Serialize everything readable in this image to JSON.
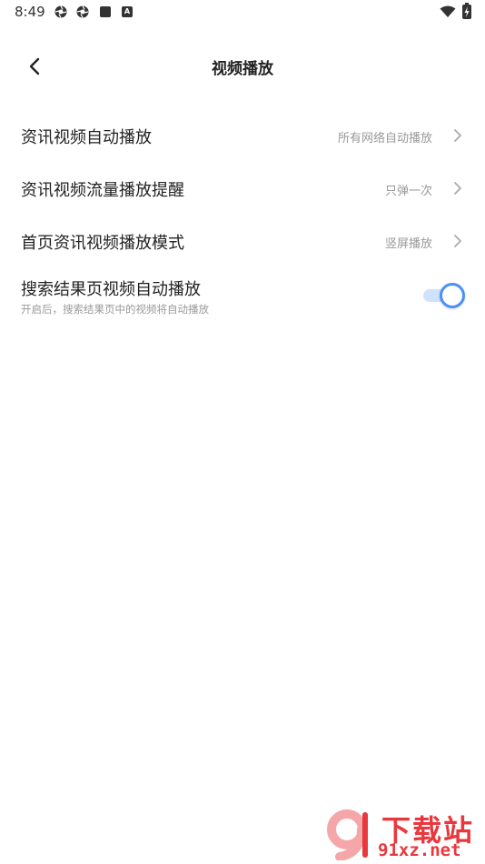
{
  "status_bar": {
    "time": "8:49",
    "badge_letter": "A",
    "icons": [
      "aperture-icon",
      "aperture-icon",
      "square-icon",
      "a-badge-icon",
      "wifi-icon",
      "battery-charging-icon"
    ]
  },
  "header": {
    "title": "视频播放",
    "back_icon": "chevron-left-icon"
  },
  "settings": {
    "items": [
      {
        "label": "资讯视频自动播放",
        "value": "所有网络自动播放"
      },
      {
        "label": "资讯视频流量播放提醒",
        "value": "只弹一次"
      },
      {
        "label": "首页资讯视频播放模式",
        "value": "竖屏播放"
      }
    ],
    "toggle_item": {
      "label": "搜索结果页视频自动播放",
      "sub": "开启后，搜索结果页中的视频将自动播放",
      "enabled": true
    }
  },
  "watermark": {
    "top": "下载站",
    "bottom": "91xz.net",
    "color": "#e8383d"
  },
  "colors": {
    "accent": "#4a90f5",
    "text_primary": "#222222",
    "text_secondary": "#999999"
  }
}
